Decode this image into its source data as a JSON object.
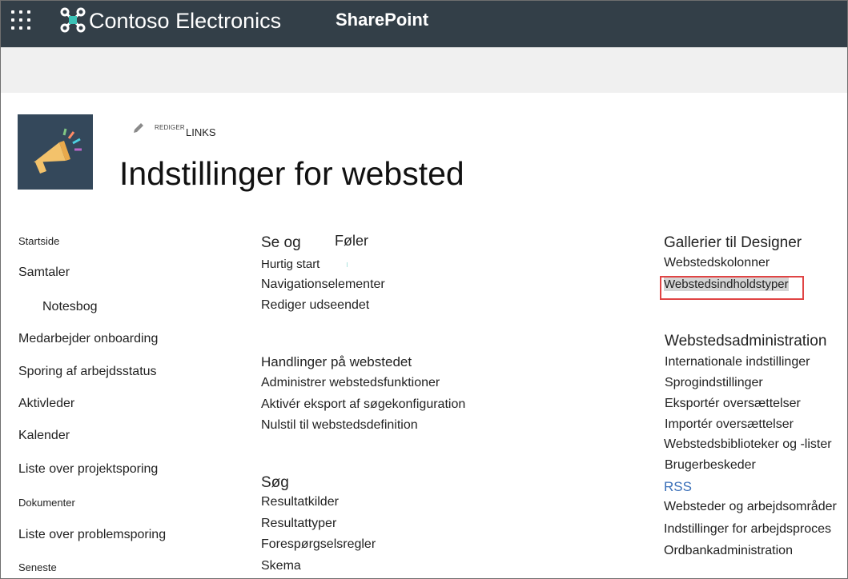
{
  "suitebar": {
    "brand": "Contoso Electronics",
    "product": "SharePoint",
    "waffle_icon": "waffle-icon",
    "logo_icon": "contoso-logo-icon"
  },
  "header": {
    "edit_small": "REDIGER",
    "edit_links": "LINKS",
    "title": "Indstillinger for websted",
    "logo_icon": "megaphone-icon"
  },
  "left_nav": [
    {
      "label": "Startside"
    },
    {
      "label": "Samtaler"
    },
    {
      "label": "Notesbog"
    },
    {
      "label": "Medarbejder onboarding"
    },
    {
      "label": "Sporing af arbejdsstatus"
    },
    {
      "label": "Aktivleder"
    },
    {
      "label": "Kalender"
    },
    {
      "label": "Liste over projektsporing"
    },
    {
      "label": "Dokumenter"
    },
    {
      "label": "Liste over problemsporing"
    },
    {
      "label": "Seneste"
    }
  ],
  "col1": {
    "look_heading_a": "Se og",
    "look_heading_b": "Føler",
    "look_links": [
      "Hurtig start",
      "Navigationselementer",
      "Rediger udseendet"
    ],
    "actions_heading": "Handlinger på webstedet",
    "actions_links": [
      "Administrer webstedsfunktioner",
      "Aktivér eksport af søgekonfiguration",
      "Nulstil til webstedsdefinition"
    ],
    "search_heading": "Søg",
    "search_links": [
      "Resultatkilder",
      "Resultattyper",
      "Forespørgselsregler",
      "Skema"
    ]
  },
  "col2": {
    "galleries_heading": "Gallerier til Designer",
    "galleries_links": [
      "Webstedskolonner",
      "Webstedsindholdstyper"
    ],
    "admin_heading": "Webstedsadministration",
    "admin_links": [
      "Internationale indstillinger",
      "Sprogindstillinger",
      "Eksportér oversættelser",
      "Importér oversættelser",
      "Webstedsbiblioteker og -lister",
      "Brugerbeskeder",
      "RSS",
      "Websteder og arbejdsområder",
      "Indstillinger for arbejdsproces",
      "Ordbankadministration"
    ]
  },
  "colors": {
    "suitebar": "#333f48",
    "highlight": "#e04444",
    "rss": "#3a6fb8"
  }
}
